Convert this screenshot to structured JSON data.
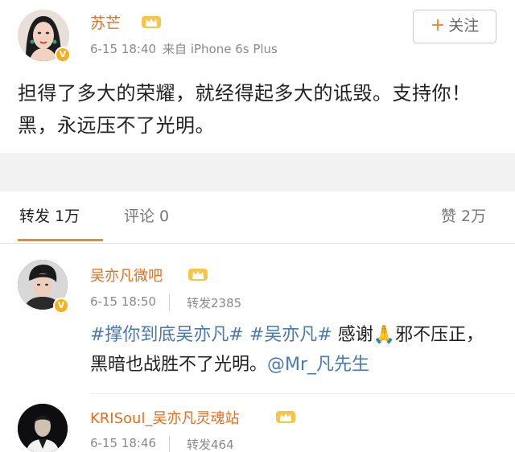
{
  "post": {
    "author": "苏芒",
    "time": "6-15 18:40",
    "source": "来自 iPhone 6s Plus",
    "follow_label": "关注",
    "follow_plus": "+",
    "text": "担得了多大的荣耀，就经得起多大的诋毁。支持你！黑，永远压不了光明。",
    "verified_badge": "V"
  },
  "tabs": {
    "repost": "转发 1万",
    "comment": "评论 0",
    "like": "赞 2万"
  },
  "reposts": [
    {
      "name": "吴亦凡微吧",
      "time": "6-15 18:50",
      "count": "转发2385",
      "text_parts": {
        "topic1": "#撑你到底吴亦凡#",
        "topic2": "#吴亦凡#",
        "thanks": "感谢",
        "emoji": "🙏",
        "rest": "邪不压正，黑暗也战胜不了光明。",
        "mention": "@Mr_凡先生"
      },
      "verified_badge": "V"
    },
    {
      "name": "KRISoul_吴亦凡灵魂站",
      "time": "6-15 18:46",
      "count": "转发464"
    }
  ],
  "colors": {
    "name_orange": "#e66f1e",
    "link_blue": "#4a78b0",
    "accent_orange": "#f08a24",
    "verified_gold": "#f3b01c"
  }
}
